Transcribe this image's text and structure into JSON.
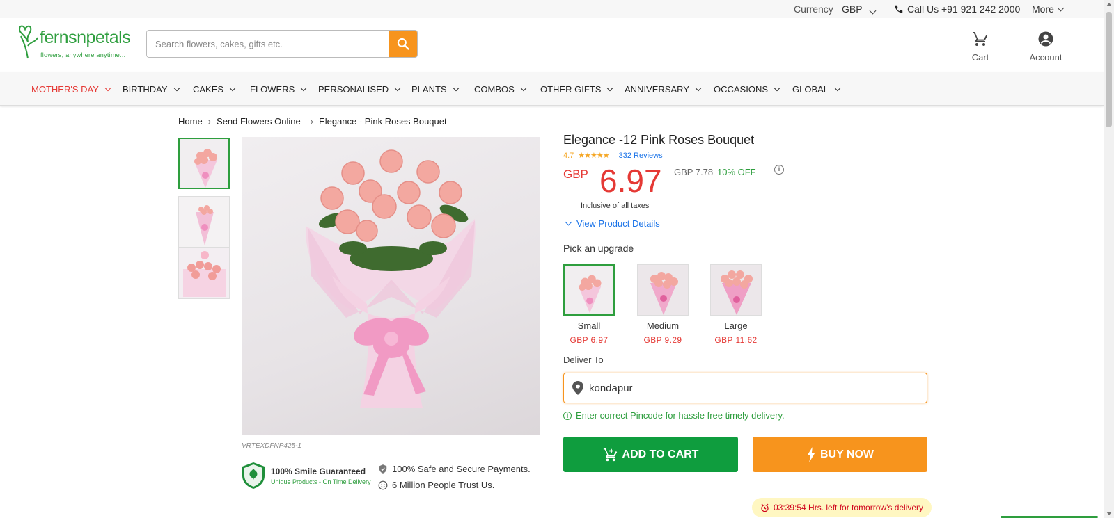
{
  "topbar": {
    "currency_label": "Currency",
    "currency_value": "GBP",
    "call_text": "Call Us +91 921 242 2000",
    "more_label": "More"
  },
  "header": {
    "brand": "fernsnpetals",
    "tagline": "flowers, anywhere anytime...",
    "search_placeholder": "Search flowers, cakes, gifts etc.",
    "cart_label": "Cart",
    "account_label": "Account"
  },
  "nav": {
    "items": [
      "MOTHER'S DAY",
      "BIRTHDAY",
      "CAKES",
      "FLOWERS",
      "PERSONALISED",
      "PLANTS",
      "COMBOS",
      "OTHER GIFTS",
      "ANNIVERSARY",
      "OCCASIONS",
      "GLOBAL"
    ]
  },
  "breadcrumb": [
    "Home",
    "Send Flowers Online",
    "Elegance - Pink Roses Bouquet"
  ],
  "gallery": {
    "sku": "VRTEXDFNP425-1"
  },
  "trust": {
    "guarantee_title": "100% Smile Guaranteed",
    "guarantee_sub": "Unique Products - On Time Delivery",
    "payments": "100% Safe and Secure Payments.",
    "people": "6 Million People Trust Us."
  },
  "product": {
    "title": "Elegance -12 Pink Roses Bouquet",
    "rating": "4.7",
    "stars": "★★★★★",
    "reviews": "332 Reviews",
    "currency": "GBP",
    "price": "6.97",
    "old_currency": "GBP",
    "old_price": "7.78",
    "discount": "10% OFF",
    "tax_note": "Inclusive of all taxes",
    "details_link": "View Product Details",
    "upgrade_label": "Pick an upgrade",
    "variants": [
      {
        "name": "Small",
        "price": "GBP  6.97"
      },
      {
        "name": "Medium",
        "price": "GBP  9.29"
      },
      {
        "name": "Large",
        "price": "GBP  11.62"
      }
    ],
    "deliver_label": "Deliver To",
    "deliver_value": "kondapur",
    "pincode_msg": "Enter correct Pincode for hassle free timely delivery.",
    "add_to_cart": "ADD TO CART",
    "buy_now": "BUY NOW",
    "timer": "03:39:54 Hrs. left for tomorrow's delivery"
  },
  "colors": {
    "brand_green": "#2e9e3e",
    "accent_orange": "#f7941d",
    "price_red": "#e53935",
    "link_blue": "#1a73e8"
  }
}
